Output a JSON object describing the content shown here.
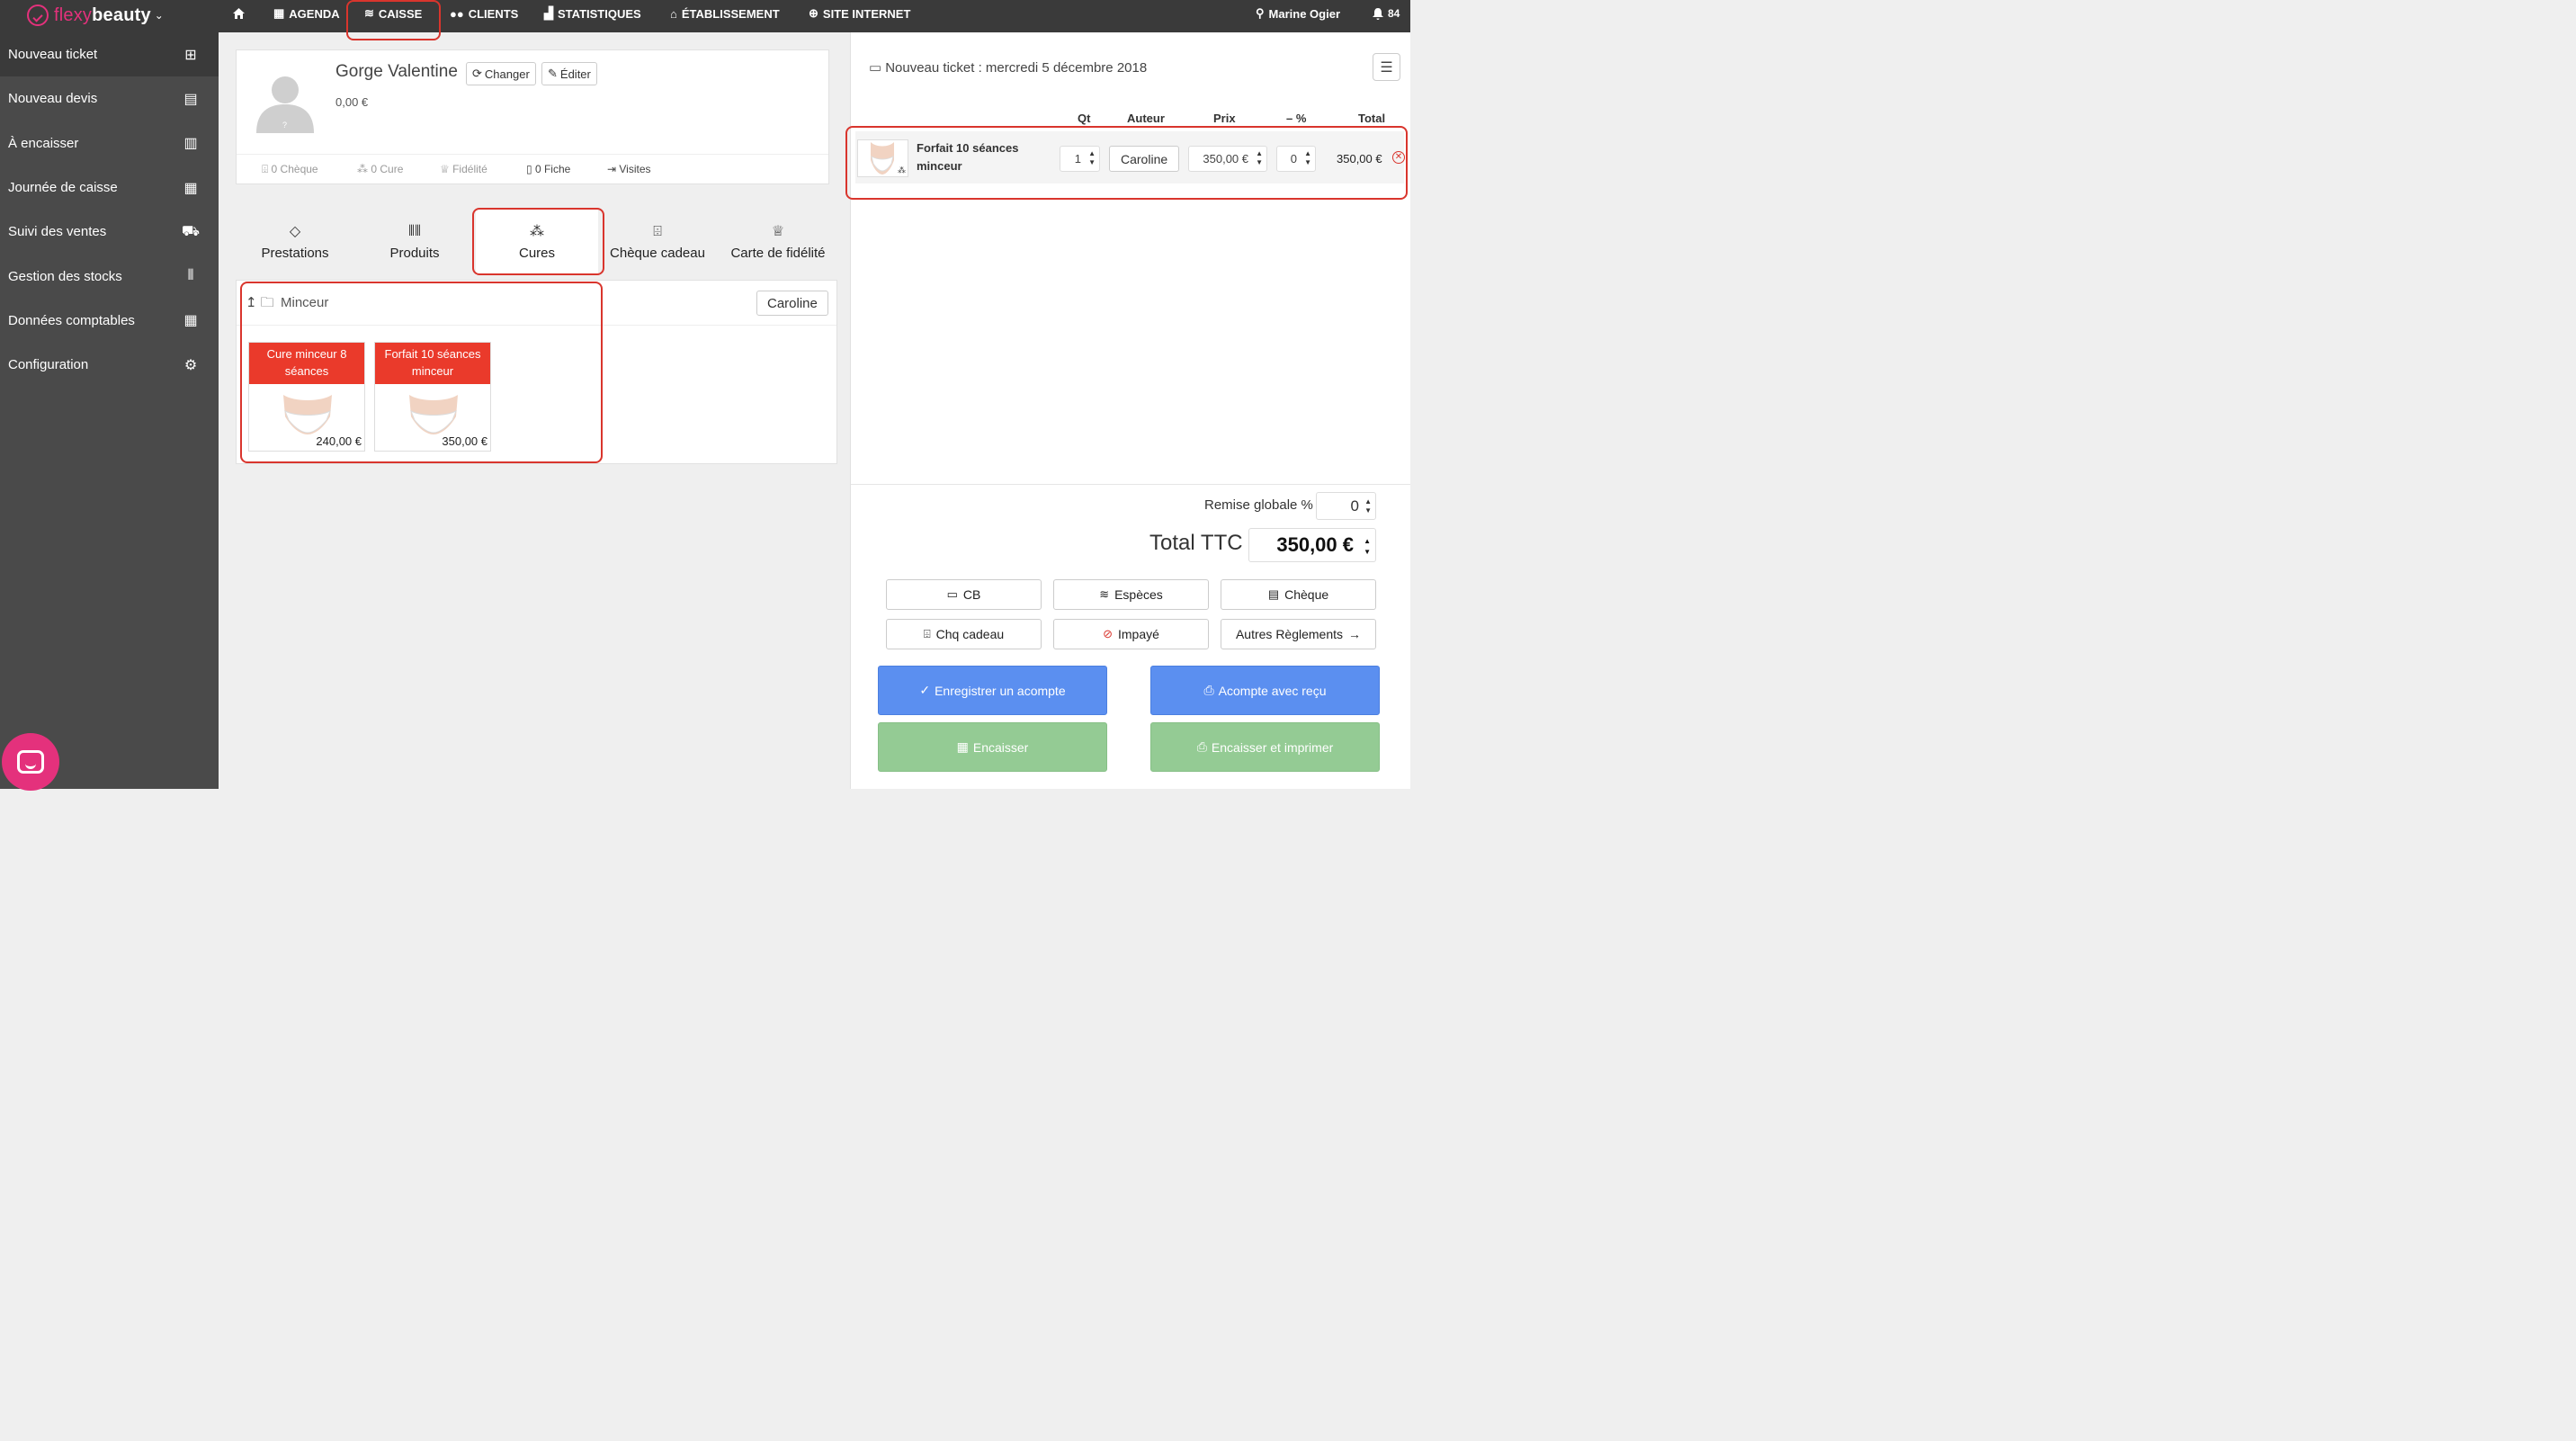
{
  "app": {
    "logo_light": "flexy",
    "logo_bold": "beauty",
    "brand_color": "#e4317c"
  },
  "nav": {
    "agenda": "AGENDA",
    "caisse": "CAISSE",
    "clients": "CLIENTS",
    "statistiques": "STATISTIQUES",
    "etablissement": "ÉTABLISSEMENT",
    "site": "SITE INTERNET",
    "user": "Marine Ogier",
    "notifications": "84"
  },
  "sidebar": {
    "items": [
      {
        "label": "Nouveau ticket",
        "icon": "new-ticket-icon"
      },
      {
        "label": "Nouveau devis",
        "icon": "new-quote-icon"
      },
      {
        "label": "À encaisser",
        "icon": "to-cash-icon"
      },
      {
        "label": "Journée de caisse",
        "icon": "cash-day-icon"
      },
      {
        "label": "Suivi des ventes",
        "icon": "cart-icon"
      },
      {
        "label": "Gestion des stocks",
        "icon": "barcode-icon"
      },
      {
        "label": "Données comptables",
        "icon": "calculator-icon"
      },
      {
        "label": "Configuration",
        "icon": "gears-icon"
      }
    ]
  },
  "client": {
    "name": "Gorge Valentine",
    "change_label": "Changer",
    "edit_label": "Éditer",
    "balance": "0,00 €",
    "stats": {
      "cheque": "0 Chèque",
      "cure": "0 Cure",
      "fidelite": "Fidélité",
      "fiche": "0 Fiche",
      "visites": "Visites"
    }
  },
  "categories": {
    "prestations": "Prestations",
    "produits": "Produits",
    "cures": "Cures",
    "cheque_cadeau": "Chèque cadeau",
    "carte_fidelite": "Carte de fidélité",
    "active": "Cures"
  },
  "folder": {
    "name": "Minceur",
    "staff": "Caroline",
    "products": [
      {
        "name": "Cure minceur 8 séances",
        "price": "240,00 €"
      },
      {
        "name": "Forfait 10 séances minceur",
        "price": "350,00 €"
      }
    ]
  },
  "ticket": {
    "title_prefix": "Nouveau ticket :",
    "date": "mercredi 5 décembre 2018",
    "columns": {
      "qt": "Qt",
      "auteur": "Auteur",
      "prix": "Prix",
      "remise": "– %",
      "total": "Total"
    },
    "line": {
      "name": "Forfait 10 séances minceur",
      "qt": "1",
      "auteur": "Caroline",
      "prix": "350,00 €",
      "remise": "0",
      "total": "350,00 €"
    },
    "remise_label": "Remise globale %",
    "remise_value": "0",
    "total_label": "Total TTC",
    "total_value": "350,00 €"
  },
  "payment": {
    "cb": "CB",
    "especes": "Espèces",
    "cheque": "Chèque",
    "chq_cadeau": "Chq cadeau",
    "impaye": "Impayé",
    "autres": "Autres Règlements",
    "acompte": "Enregistrer un acompte",
    "acompte_recu": "Acompte avec reçu",
    "encaisser": "Encaisser",
    "encaisser_imprimer": "Encaisser et imprimer"
  },
  "colors": {
    "accent_red": "#ea3a2b",
    "highlight": "#d9352d",
    "blue_button": "#5b8ff0",
    "green_button": "#94cb94"
  }
}
